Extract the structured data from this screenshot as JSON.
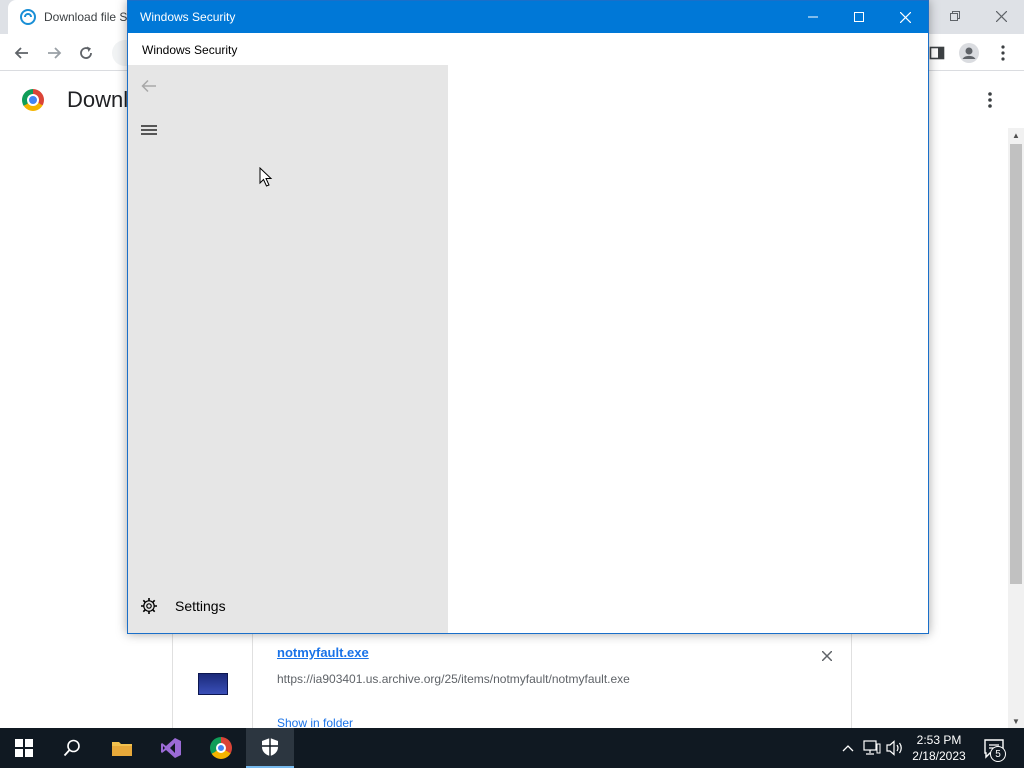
{
  "browser": {
    "tab_title": "Download file S",
    "page_title": "Downl",
    "download": {
      "file_name": "notmyfault.exe",
      "url": "https://ia903401.us.archive.org/25/items/notmyfault/notmyfault.exe",
      "show_in_folder": "Show in folder"
    }
  },
  "security_window": {
    "titlebar_title": "Windows Security",
    "app_title": "Windows Security",
    "nav": {
      "settings_label": "Settings"
    },
    "accent_color": "#0078d7"
  },
  "taskbar": {
    "time": "2:53 PM",
    "date": "2/18/2023",
    "notification_count": "5",
    "pinned": [
      "start-icon",
      "search-icon",
      "file-explorer-icon",
      "visual-studio-icon",
      "chrome-icon",
      "windows-security-icon"
    ]
  }
}
